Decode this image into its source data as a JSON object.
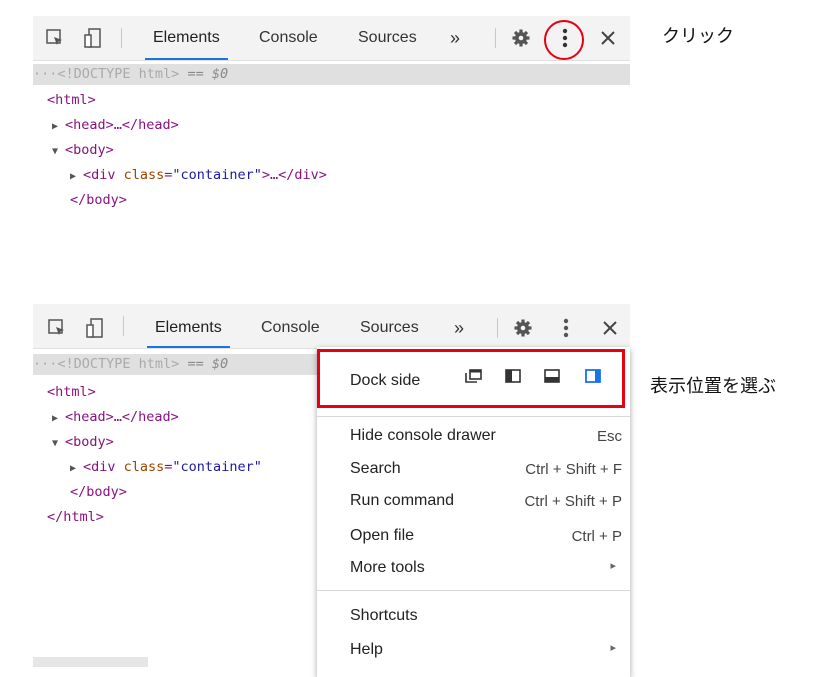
{
  "top": {
    "tabs": {
      "elements": "Elements",
      "console": "Console",
      "sources": "Sources",
      "more": "»"
    },
    "doctype": "<!DOCTYPE html>",
    "sel_suffix": " == $0",
    "ellipsis": "···",
    "lines": {
      "html_open": "<html>",
      "head": "<head>…</head>",
      "body_open": "<body>",
      "div_attr": "class",
      "div_val": "\"container\"",
      "div_rest": ">…</div>",
      "body_close": "</body>"
    },
    "annotation": "クリック"
  },
  "bottom": {
    "tabs": {
      "elements": "Elements",
      "console": "Console",
      "sources": "Sources",
      "more": "»"
    },
    "doctype": "<!DOCTYPE html>",
    "sel_suffix": " == $0",
    "ellipsis": "···",
    "lines": {
      "html_open": "<html>",
      "head": "<head>…</head>",
      "body_open": "<body>",
      "div_attr": "class",
      "div_val": "\"container\"",
      "body_close": "</body>",
      "html_close": "</html>"
    },
    "annotation": "表示位置を選ぶ"
  },
  "menu": {
    "dock_side": "Dock side",
    "items": [
      {
        "label": "Hide console drawer",
        "shortcut": "Esc"
      },
      {
        "label": "Search",
        "shortcut": "Ctrl + Shift + F"
      },
      {
        "label": "Run command",
        "shortcut": "Ctrl + Shift + P"
      },
      {
        "label": "Open file",
        "shortcut": "Ctrl + P"
      },
      {
        "label": "More tools",
        "shortcut": "▸"
      },
      {
        "label": "Shortcuts",
        "shortcut": ""
      },
      {
        "label": "Help",
        "shortcut": "▸"
      }
    ]
  },
  "colors": {
    "accent": "#1a73e8",
    "highlight": "#e60012",
    "tag": "#881280",
    "attr": "#994500",
    "value": "#1a1aa6"
  },
  "icons": [
    "inspect-element-icon",
    "device-toolbar-icon",
    "settings-gear-icon",
    "more-vertical-icon",
    "close-icon",
    "dock-undock-icon",
    "dock-left-icon",
    "dock-bottom-icon",
    "dock-right-icon"
  ]
}
